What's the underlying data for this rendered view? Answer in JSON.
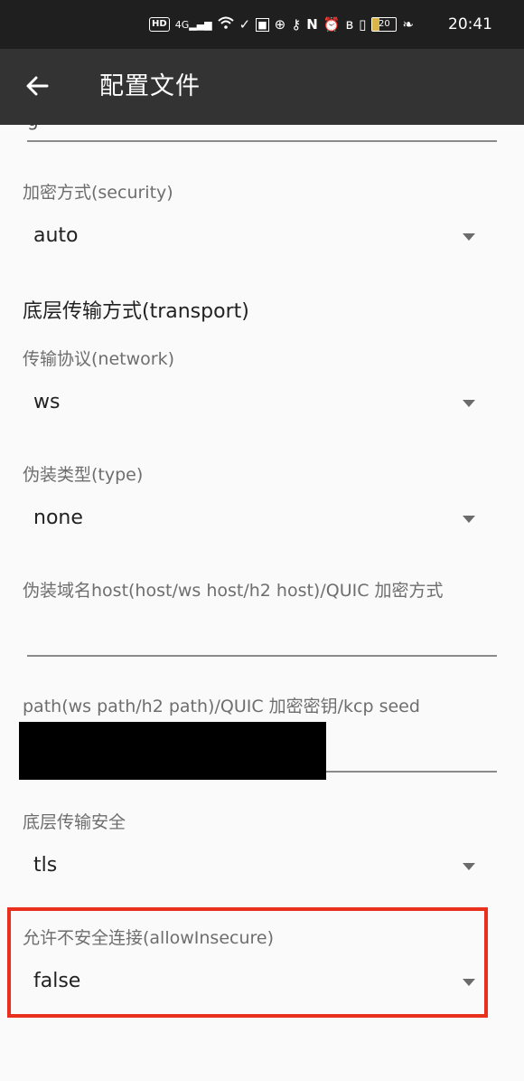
{
  "status_bar": {
    "hd": "HD",
    "network": "4G",
    "battery": "20",
    "time": "20:41"
  },
  "app_bar": {
    "title": "配置文件",
    "back_icon": "arrow-left-icon"
  },
  "form": {
    "prev_value_peek": "g",
    "security": {
      "label": "加密方式(security)",
      "value": "auto"
    },
    "transport_heading": "底层传输方式(transport)",
    "network": {
      "label": "传输协议(network)",
      "value": "ws"
    },
    "type": {
      "label": "伪装类型(type)",
      "value": "none"
    },
    "host": {
      "label": "伪装域名host(host/ws host/h2 host)/QUIC 加密方式",
      "value": ""
    },
    "path": {
      "label": "path(ws path/h2 path)/QUIC 加密密钥/kcp seed",
      "value": ""
    },
    "stream_security": {
      "label": "底层传输安全",
      "value": "tls"
    },
    "allow_insecure": {
      "label": "允许不安全连接(allowInsecure)",
      "value": "false"
    }
  },
  "colors": {
    "highlight": "#e8301c",
    "app_bar": "#333333",
    "status_bar": "#1f1f1f"
  }
}
